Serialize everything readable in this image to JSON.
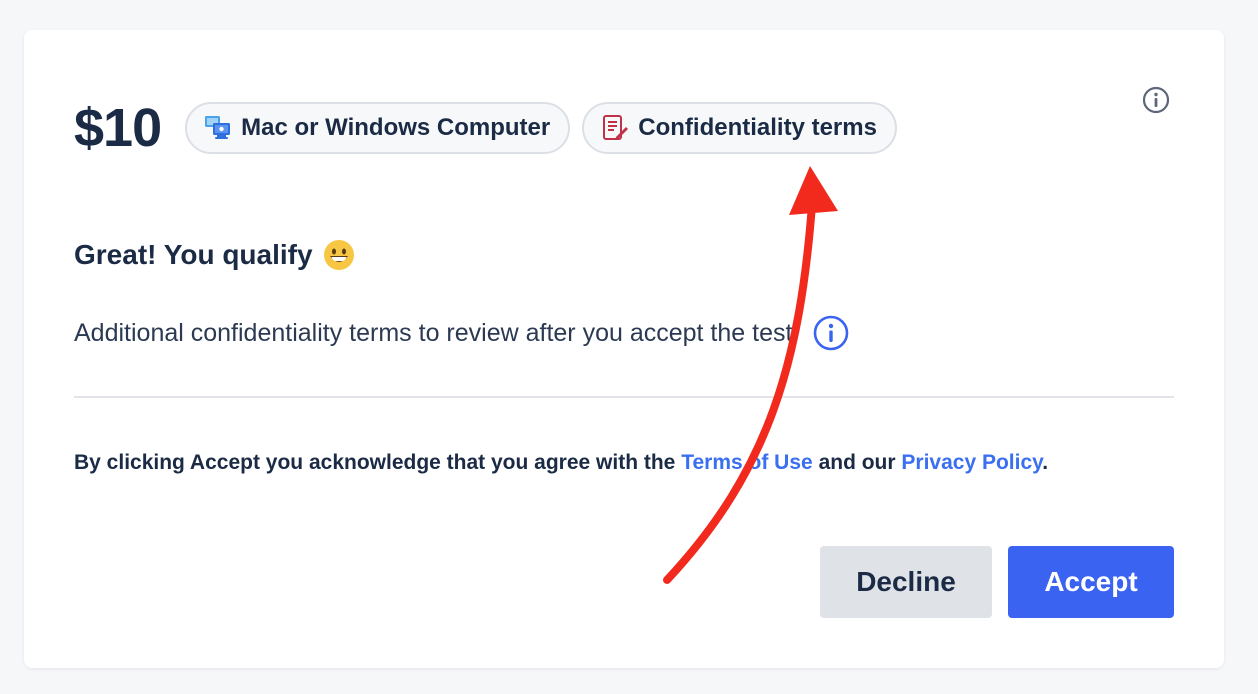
{
  "offer": {
    "price": "$10",
    "chips": [
      {
        "label": "Mac or Windows Computer",
        "icon": "computer-icon"
      },
      {
        "label": "Confidentiality terms",
        "icon": "document-pen-icon"
      }
    ]
  },
  "status": {
    "heading": "Great! You qualify",
    "emoji": "grinning-face-icon"
  },
  "note": {
    "text": "Additional confidentiality terms to review after you accept the test."
  },
  "legal": {
    "prefix": "By clicking Accept you acknowledge that you agree with the",
    "terms_link": "Terms of Use",
    "middle": "and our",
    "privacy_link": "Privacy Policy",
    "suffix": "."
  },
  "actions": {
    "decline_label": "Decline",
    "accept_label": "Accept"
  },
  "colors": {
    "accent": "#3a63f2",
    "link": "#3a6ff0",
    "annotation_arrow": "#f2291d",
    "text": "#1b2b45"
  }
}
